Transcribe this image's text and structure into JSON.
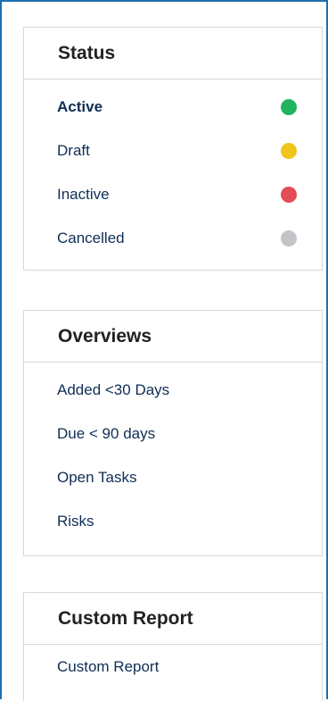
{
  "status_panel": {
    "title": "Status",
    "items": [
      {
        "label": "Active",
        "dot_color": "#22b35e"
      },
      {
        "label": "Draft",
        "dot_color": "#f0c419"
      },
      {
        "label": "Inactive",
        "dot_color": "#e24c54"
      },
      {
        "label": "Cancelled",
        "dot_color": "#c2c4c8"
      }
    ]
  },
  "overviews_panel": {
    "title": "Overviews",
    "items": [
      {
        "label": "Added <30 Days"
      },
      {
        "label": "Due < 90 days"
      },
      {
        "label": "Open Tasks"
      },
      {
        "label": "Risks"
      }
    ]
  },
  "custom_panel": {
    "title": "Custom Report",
    "items": [
      {
        "label": "Custom Report"
      }
    ]
  },
  "colors": {
    "frame_border": "#1e6fb0",
    "link_text": "#0f2e55"
  }
}
